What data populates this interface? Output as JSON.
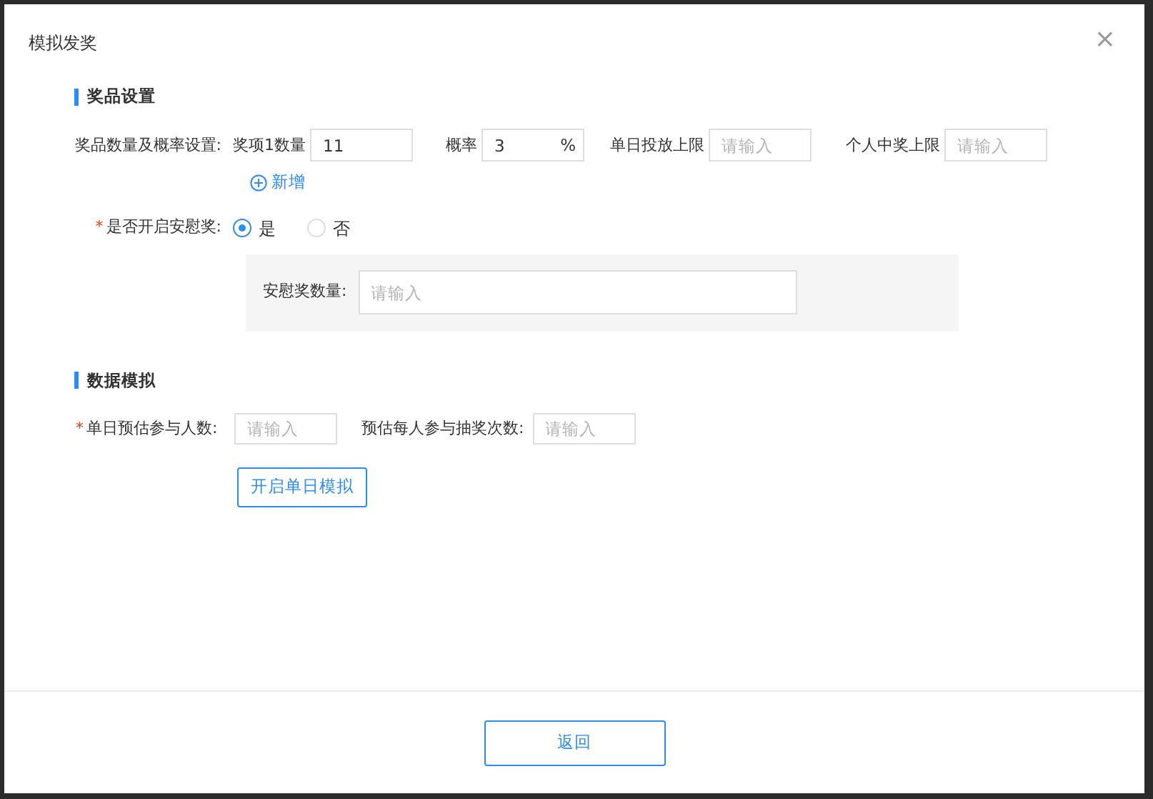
{
  "dialog": {
    "title": "模拟发奖",
    "close": "×"
  },
  "prize_section": {
    "heading": "奖品设置",
    "label": "奖品数量及概率设置:",
    "fields": [
      {
        "label": "奖项1数量",
        "value": "11"
      },
      {
        "label": "概率",
        "value": "3",
        "suffix": "%"
      },
      {
        "label": "单日投放上限",
        "placeholder": "请输入"
      },
      {
        "label": "个人中奖上限",
        "placeholder": "请输入"
      }
    ],
    "add_link": "新增",
    "consolation": {
      "label": "是否开启安慰奖:",
      "required_mark": "*",
      "options": [
        {
          "label": "是",
          "selected": true
        },
        {
          "label": "否",
          "selected": false
        }
      ],
      "count_label": "安慰奖数量:",
      "count_placeholder": "请输入"
    }
  },
  "simulation_section": {
    "heading": "数据模拟",
    "fields": [
      {
        "label": "单日预估参与人数:",
        "required_mark": "*",
        "placeholder": "请输入"
      },
      {
        "label": "预估每人参与抽奖次数:",
        "placeholder": "请输入"
      }
    ],
    "button": "开启单日模拟"
  },
  "footer": {
    "button": "返回"
  }
}
